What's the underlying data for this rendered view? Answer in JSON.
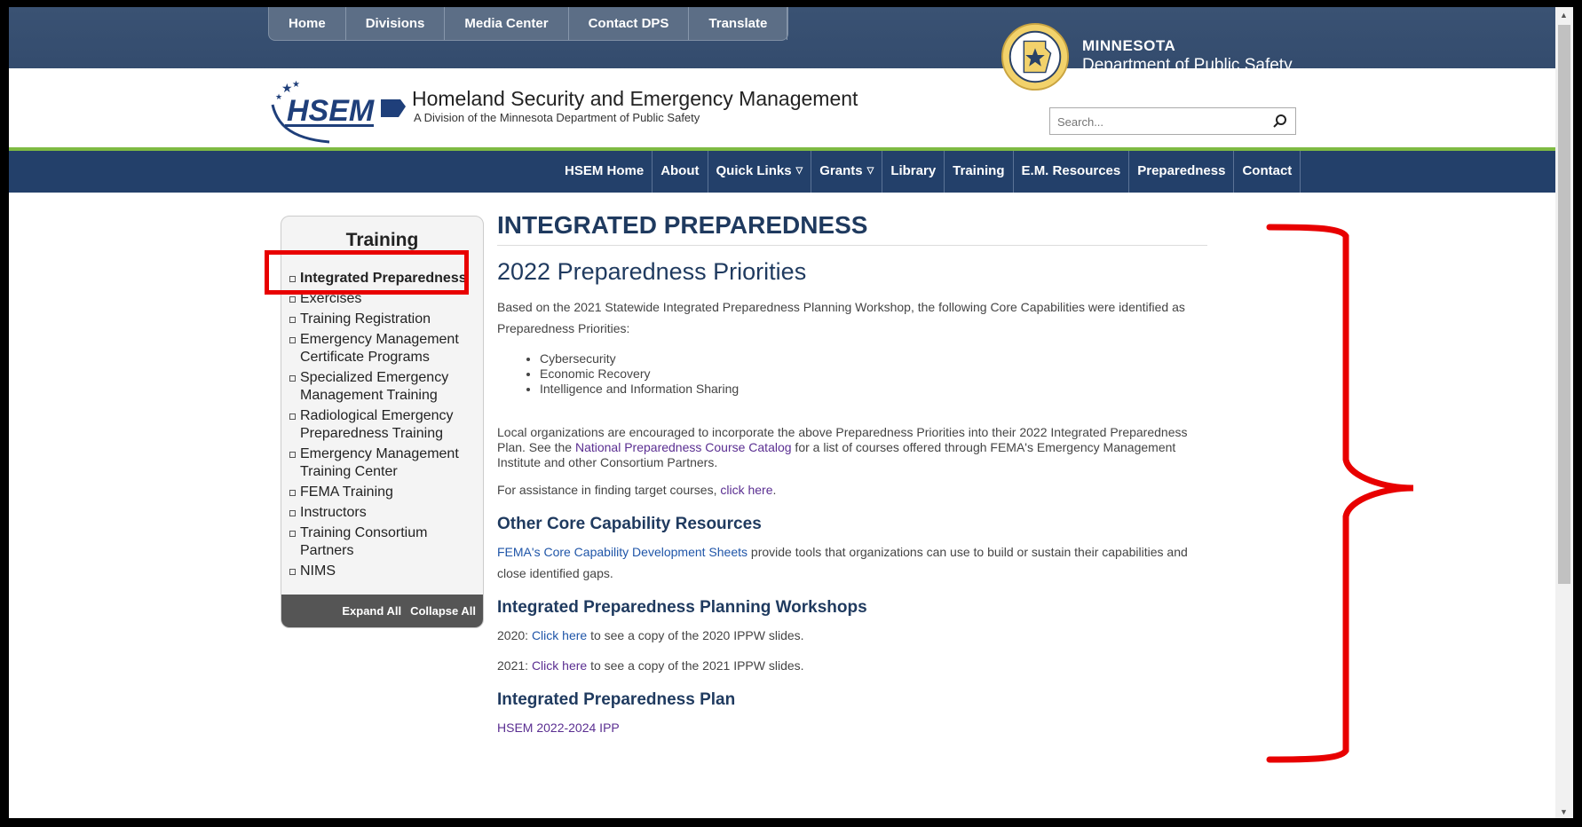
{
  "utility_nav": [
    "Home",
    "Divisions",
    "Media Center",
    "Contact DPS",
    "Translate"
  ],
  "agency": {
    "line1": "MINNESOTA",
    "line2": "Department of Public Safety"
  },
  "site": {
    "logo_text": "HSEM",
    "title": "Homeland Security and Emergency Management",
    "subtitle": "A Division of the Minnesota Department of Public Safety"
  },
  "search": {
    "placeholder": "Search..."
  },
  "main_nav": [
    {
      "label": "HSEM Home"
    },
    {
      "label": "About"
    },
    {
      "label": "Quick Links",
      "caret": "▽"
    },
    {
      "label": "Grants",
      "caret": "▽"
    },
    {
      "label": "Library"
    },
    {
      "label": "Training"
    },
    {
      "label": "E.M. Resources"
    },
    {
      "label": "Preparedness"
    },
    {
      "label": "Contact"
    }
  ],
  "sidebar": {
    "title": "Training",
    "items": [
      "Integrated Preparedness",
      "Exercises",
      "Training Registration",
      "Emergency Management Certificate Programs",
      "Specialized Emergency Management Training",
      "Radiological Emergency Preparedness Training",
      "Emergency Management Training Center",
      "FEMA Training",
      "Instructors",
      "Training Consortium Partners",
      "NIMS"
    ],
    "expand_all": "Expand All",
    "collapse_all": "Collapse All"
  },
  "content": {
    "page_title": "INTEGRATED PREPAREDNESS",
    "section_title": "2022 Preparedness Priorities",
    "intro": "Based on the 2021 Statewide Integrated Preparedness Planning Workshop, the following Core Capabilities were identified as Preparedness Priorities:",
    "priorities": [
      "Cybersecurity",
      "Economic Recovery",
      "Intelligence and Information Sharing"
    ],
    "local_text_1": "Local organizations are encouraged to incorporate the above Preparedness Priorities into their 2022 Integrated Preparedness Plan.  See the ",
    "local_link": "National Preparedness Course Catalog",
    "local_text_2": " for a list of courses offered through FEMA's Emergency Management Institute and other Consortium Partners.",
    "assist_text": "For assistance in finding target courses, ",
    "assist_link": "click here",
    "assist_end": ".",
    "h_other": "Other Core Capability Resources",
    "fema_link": "FEMA's Core Capability Development Sheets",
    "fema_text": " provide tools that organizations can use to build or sustain their capabilities and close identified gaps.",
    "h_workshops": "Integrated Preparedness Planning Workshops",
    "ws2020_year": "2020: ",
    "ws2020_link": "Click here",
    "ws2020_text": " to see a copy of the 2020 IPPW slides.",
    "ws2021_year": "2021: ",
    "ws2021_link": "Click here",
    "ws2021_text": " to see a copy of the 2021 IPPW slides.",
    "h_plan": "Integrated Preparedness Plan",
    "plan_link": "HSEM 2022-2024 IPP"
  },
  "colors": {
    "annotation": "#e80000",
    "nav_bg": "#23406a",
    "accent_green": "#7fba43"
  }
}
